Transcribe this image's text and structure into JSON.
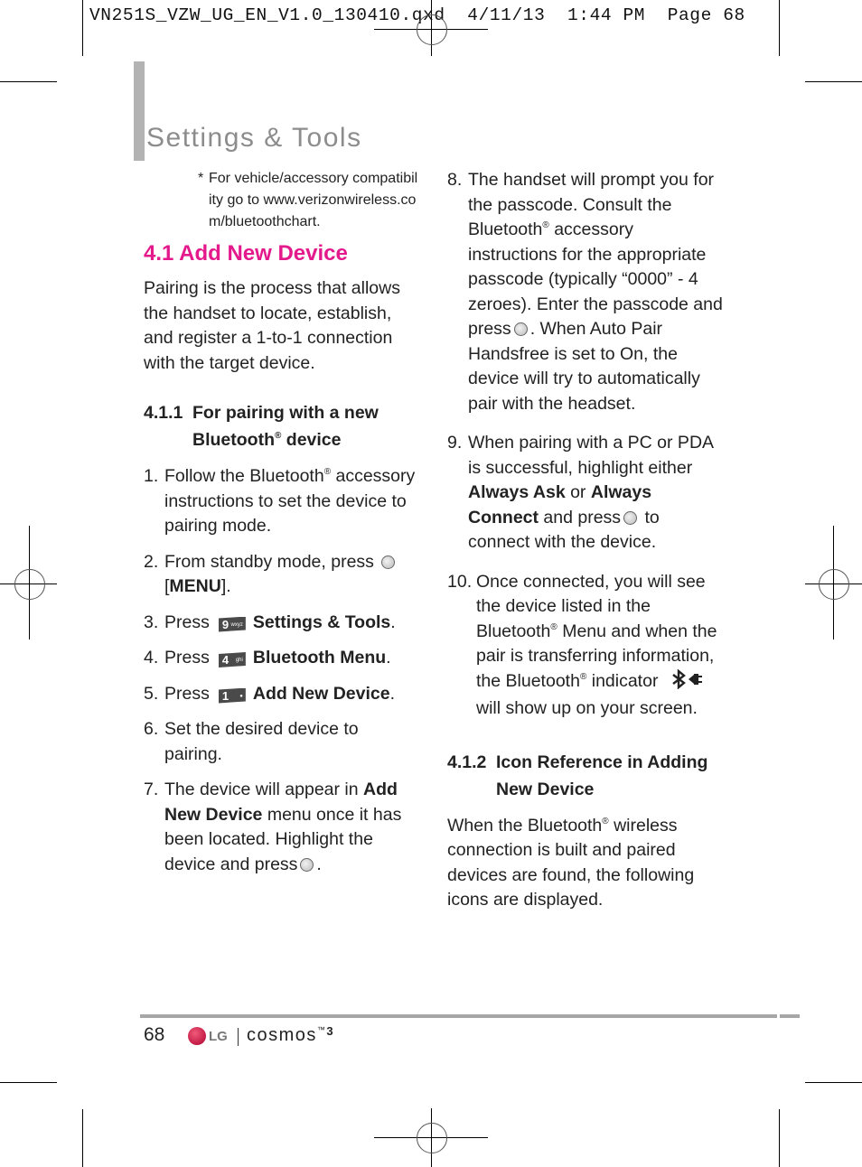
{
  "slug": "VN251S_VZW_UG_EN_V1.0_130410.qxd  4/11/13  1:44 PM  Page 68",
  "header": {
    "title": "Settings & Tools"
  },
  "note": {
    "marker": "*",
    "text": "For vehicle/accessory compatibility go to www.verizonwireless.com/bluetoothchart."
  },
  "section": {
    "title": "4.1 Add New Device",
    "intro": "Pairing is the process that allows the handset to locate, establish, and register a 1-to-1 connection with the target device."
  },
  "subsection_1": {
    "number": "4.1.1",
    "title_a": "For pairing with a new Bluetooth",
    "reg": "®",
    "title_b": " device"
  },
  "steps": [
    {
      "n": "1.",
      "a": "Follow the Bluetooth",
      "reg": "®",
      "b": " accessory instructions to set the device to pairing mode."
    },
    {
      "n": "2.",
      "a": "From standby mode, press",
      "b": "[",
      "bold": "MENU",
      "c": "]."
    },
    {
      "n": "3.",
      "a": "Press",
      "key": "9",
      "key_sub": "wxyz",
      "bold": "Settings & Tools",
      "c": "."
    },
    {
      "n": "4.",
      "a": "Press",
      "key": "4",
      "key_sub": "ghi",
      "bold": "Bluetooth Menu",
      "c": "."
    },
    {
      "n": "5.",
      "a": "Press",
      "key": "1",
      "key_sub": "",
      "bold": "Add New Device",
      "c": "."
    },
    {
      "n": "6.",
      "a": "Set the desired device to pairing."
    },
    {
      "n": "7.",
      "a": "The device will appear in ",
      "bold": "Add New Device",
      "b": " menu once it has been located. Highlight the device and press",
      "c": "."
    },
    {
      "n": "8.",
      "a": "The handset will prompt you for the passcode. Consult the Bluetooth",
      "reg": "®",
      "b": " accessory instructions for the appropriate passcode (typically “0000” - 4 zeroes). Enter the passcode and press",
      "c": ". When Auto Pair Handsfree is set to On, the device will try to automatically pair with the headset."
    },
    {
      "n": "9.",
      "a": "When pairing with a PC or PDA is successful, highlight either ",
      "bold1": "Always Ask",
      "or": " or ",
      "bold2": "Always Connect",
      "b": " and press",
      "c": " to connect with the device."
    },
    {
      "n": "10.",
      "a": "Once connected, you will see the device listed in the Bluetooth",
      "reg": "®",
      "b": " Menu and when the pair is transferring information, the Bluetooth",
      "reg2": "®",
      "c": " indicator",
      "d": " will show up on your screen."
    }
  ],
  "subsection_2": {
    "number": "4.1.2",
    "title": "Icon Reference in Adding New Device",
    "text_a": "When the Bluetooth",
    "reg": "®",
    "text_b": " wireless connection is built and paired devices are found, the following icons are displayed."
  },
  "footer": {
    "page_number": "68",
    "logo_text": "LG",
    "brand": "cosmos",
    "brand_sup": "™",
    "brand_num": "3"
  },
  "colors": {
    "section_heading": "#e4198c",
    "title": "#8c8c8c",
    "title_bar": "#b3b3b3",
    "rule": "#a6a6a6"
  }
}
